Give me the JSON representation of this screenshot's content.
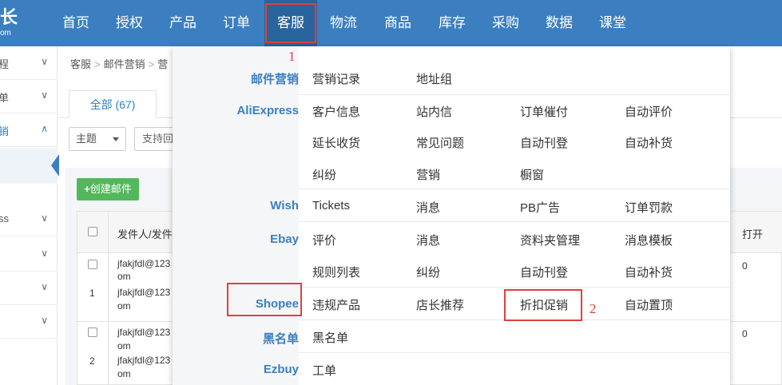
{
  "logo": {
    "big": "长",
    "small": "om"
  },
  "nav": [
    "首页",
    "授权",
    "产品",
    "订单",
    "客服",
    "物流",
    "商品",
    "库存",
    "采购",
    "数据",
    "课堂"
  ],
  "sidebar": {
    "items": [
      "程",
      "单",
      "销",
      "",
      "ss",
      "",
      "",
      ""
    ]
  },
  "breadcrumb": [
    "客服",
    "邮件营销",
    "营"
  ],
  "tab_all": "全部 (67)",
  "filter": {
    "select_value": "主题",
    "input_placeholder": "支持回"
  },
  "create_button": "创建邮件",
  "table": {
    "headers": {
      "sender": "发件人/发件",
      "open": "打开"
    },
    "rows": [
      {
        "index": "1",
        "sender": [
          "jfakjfdl@123",
          "om",
          "jfakjfdl@123",
          "om"
        ],
        "open": "0"
      },
      {
        "index": "2",
        "sender": [
          "jfakjfdl@123",
          "om",
          "jfakjfdl@123",
          "om"
        ],
        "open": "0"
      }
    ]
  },
  "dropdown": {
    "categories": [
      "邮件营销",
      "AliExpress",
      "Wish",
      "Ebay",
      "Shopee",
      "黑名单",
      "Ezbuy"
    ],
    "rows": [
      [
        "营销记录",
        "地址组",
        "",
        ""
      ],
      [
        "客户信息",
        "站内信",
        "订单催付",
        "自动评价"
      ],
      [
        "延长收货",
        "常见问题",
        "自动刊登",
        "自动补货"
      ],
      [
        "纠纷",
        "营销",
        "橱窗",
        ""
      ],
      [
        "Tickets",
        "消息",
        "PB广告",
        "订单罚款"
      ],
      [
        "评价",
        "消息",
        "资料夹管理",
        "消息模板"
      ],
      [
        "规则列表",
        "纠纷",
        "自动刊登",
        "自动补货"
      ],
      [
        "违规产品",
        "店长推荐",
        "折扣促销",
        "自动置顶"
      ],
      [
        "黑名单",
        "",
        "",
        ""
      ],
      [
        "工单",
        "",
        "",
        ""
      ]
    ]
  },
  "annotations": [
    "1",
    "2"
  ],
  "colors": {
    "nav_bg": "#3b7fc1",
    "nav_active": "#2a649d",
    "accent": "#3b7fc1",
    "highlight_red": "#e0403a",
    "green_button": "#53b85c"
  }
}
